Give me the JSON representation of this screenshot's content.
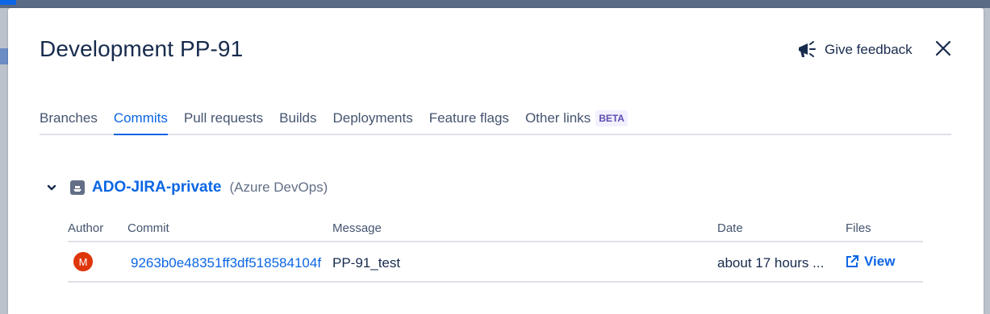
{
  "dialog": {
    "title": "Development PP-91",
    "feedback_label": "Give feedback"
  },
  "tabs": [
    {
      "label": "Branches"
    },
    {
      "label": "Commits",
      "active": true
    },
    {
      "label": "Pull requests"
    },
    {
      "label": "Builds"
    },
    {
      "label": "Deployments"
    },
    {
      "label": "Feature flags"
    },
    {
      "label": "Other links",
      "badge": "BETA"
    }
  ],
  "repository": {
    "name": "ADO-JIRA-private",
    "provider": "(Azure DevOps)"
  },
  "table": {
    "columns": [
      "Author",
      "Commit",
      "Message",
      "Date",
      "Files"
    ],
    "rows": [
      {
        "author_initial": "M",
        "commit": "9263b0e48351ff3df518584104f",
        "message": "PP-91_test",
        "date": "about 17 hours ...",
        "files_label": "View"
      }
    ]
  },
  "colors": {
    "accent": "#0c66e4",
    "text": "#172b4d",
    "avatar": "#de350b",
    "badge_bg": "#f3f0ff",
    "badge_text": "#5e4db2"
  },
  "icons": {
    "feedback": "megaphone-icon",
    "close": "close-icon",
    "expand": "chevron-down-icon",
    "repo": "repository-icon",
    "view": "external-link-icon"
  }
}
